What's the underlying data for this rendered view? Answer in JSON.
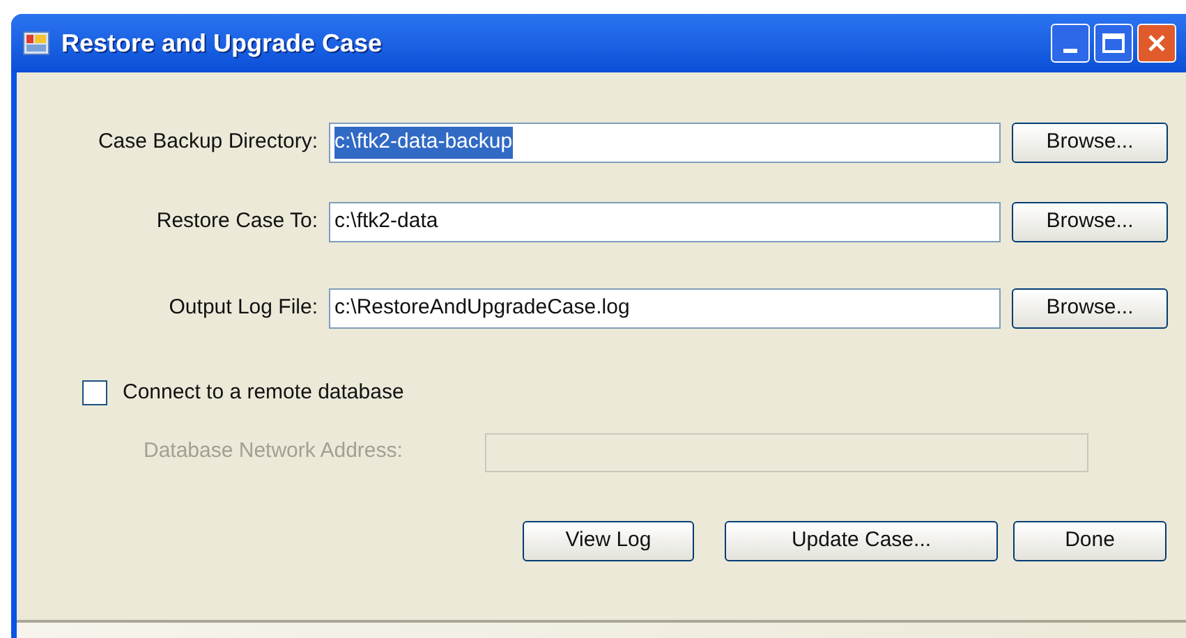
{
  "window": {
    "title": "Restore and Upgrade Case"
  },
  "fields": [
    {
      "label": "Case Backup Directory:",
      "value": "c:\\ftk2-data-backup",
      "text_selected": true,
      "button": "Browse..."
    },
    {
      "label": "Restore Case To:",
      "value": "c:\\ftk2-data",
      "text_selected": false,
      "button": "Browse..."
    },
    {
      "label": "Output Log File:",
      "value": "c:\\RestoreAndUpgradeCase.log",
      "text_selected": false,
      "button": "Browse..."
    }
  ],
  "remote": {
    "label": "Connect to a remote database",
    "checked": false
  },
  "network_address": {
    "label": "Database Network Address:",
    "disabled": true
  },
  "buttons": [
    "View Log",
    "Update Case...",
    "Done"
  ]
}
